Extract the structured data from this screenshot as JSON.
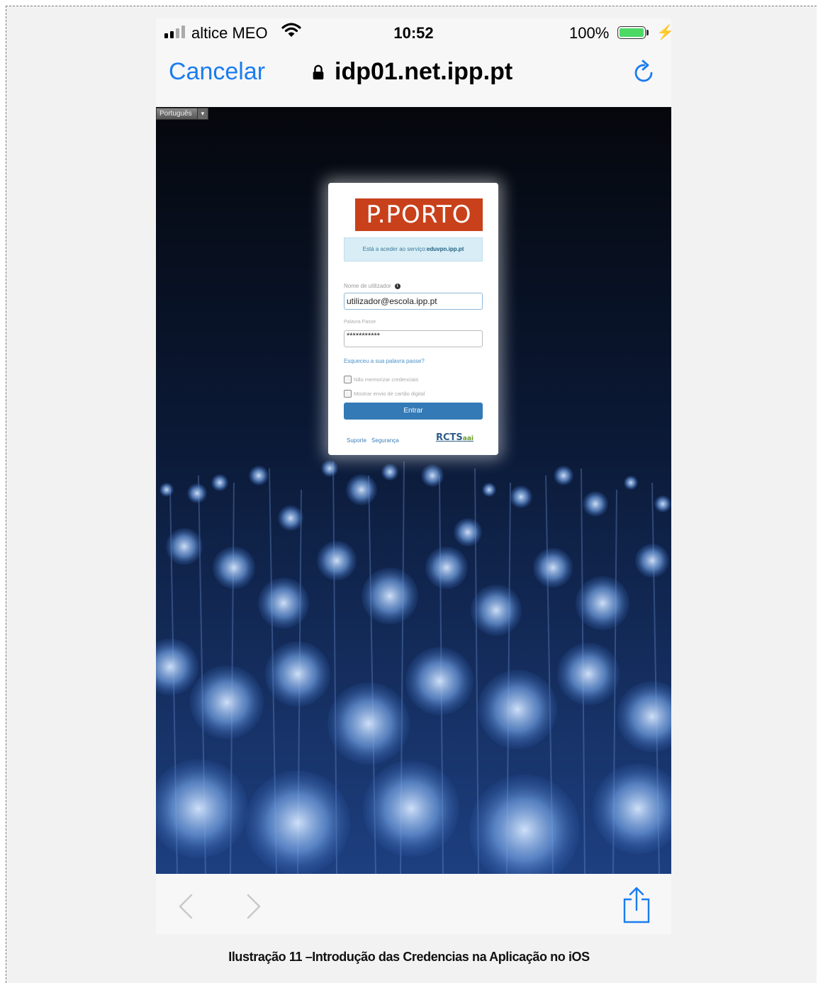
{
  "status_bar": {
    "carrier": "altice MEO",
    "time": "10:52",
    "battery": "100%"
  },
  "nav_bar": {
    "cancel_label": "Cancelar",
    "url": "idp01.net.ipp.pt"
  },
  "language_selector": {
    "selected": "Português"
  },
  "login_card": {
    "logo_text": "P.PORTO",
    "service_prefix": "Está a aceder ao serviço:",
    "service_name": "eduvpn.ipp.pt",
    "username_label": "Nome de utilizador",
    "username_value": "utilizador@escola.ipp.pt",
    "password_label": "Palavra Passe",
    "password_value": "***********",
    "forgot_link": "Esqueceu a sua palavra passe?",
    "checkbox_remember": "Não memorizar credenciais",
    "checkbox_digital_card": "Mostrar envio de cartão digital",
    "submit_label": "Entrar",
    "footer_support": "Suporte",
    "footer_security": "Segurança",
    "rcts_logo_text": "RCTS",
    "rcts_logo_suffix": "aai"
  },
  "caption": "Ilustração 11 –Introdução das Credencias na Aplicação no iOS",
  "colors": {
    "ios_blue": "#1a7cf0",
    "brand_orange": "#c8411b",
    "button_blue": "#337ab7",
    "battery_green": "#4cd964"
  }
}
